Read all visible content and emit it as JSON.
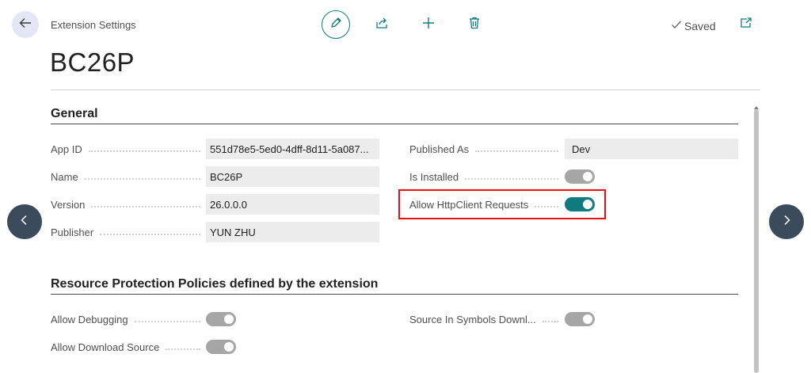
{
  "header": {
    "caption": "Extension Settings",
    "title": "BC26P",
    "saved_label": "Saved"
  },
  "toolbar": {
    "icons": [
      "edit-icon",
      "share-icon",
      "plus-icon",
      "delete-icon",
      "open-new-window-icon"
    ]
  },
  "general": {
    "title": "General",
    "left_fields": [
      {
        "label": "App ID",
        "value": "551d78e5-5ed0-4dff-8d11-5a087..."
      },
      {
        "label": "Name",
        "value": "BC26P"
      },
      {
        "label": "Version",
        "value": "26.0.0.0"
      },
      {
        "label": "Publisher",
        "value": "YUN ZHU"
      }
    ],
    "published_as": {
      "label": "Published As",
      "value": "Dev"
    },
    "is_installed": {
      "label": "Is Installed",
      "on": true
    },
    "allow_http": {
      "label": "Allow HttpClient Requests",
      "on": true
    }
  },
  "resource": {
    "title": "Resource Protection Policies defined by the extension",
    "allow_debugging": {
      "label": "Allow Debugging",
      "on": true
    },
    "allow_download": {
      "label": "Allow Download Source",
      "on": true
    },
    "source_in_symbols": {
      "label": "Source In Symbols Downl...",
      "on": true
    }
  },
  "colors": {
    "accent": "#0f7b7f",
    "toggle_disabled": "#a6a6a6",
    "highlight": "#e81010",
    "nav_circle": "#3b4b5c"
  }
}
